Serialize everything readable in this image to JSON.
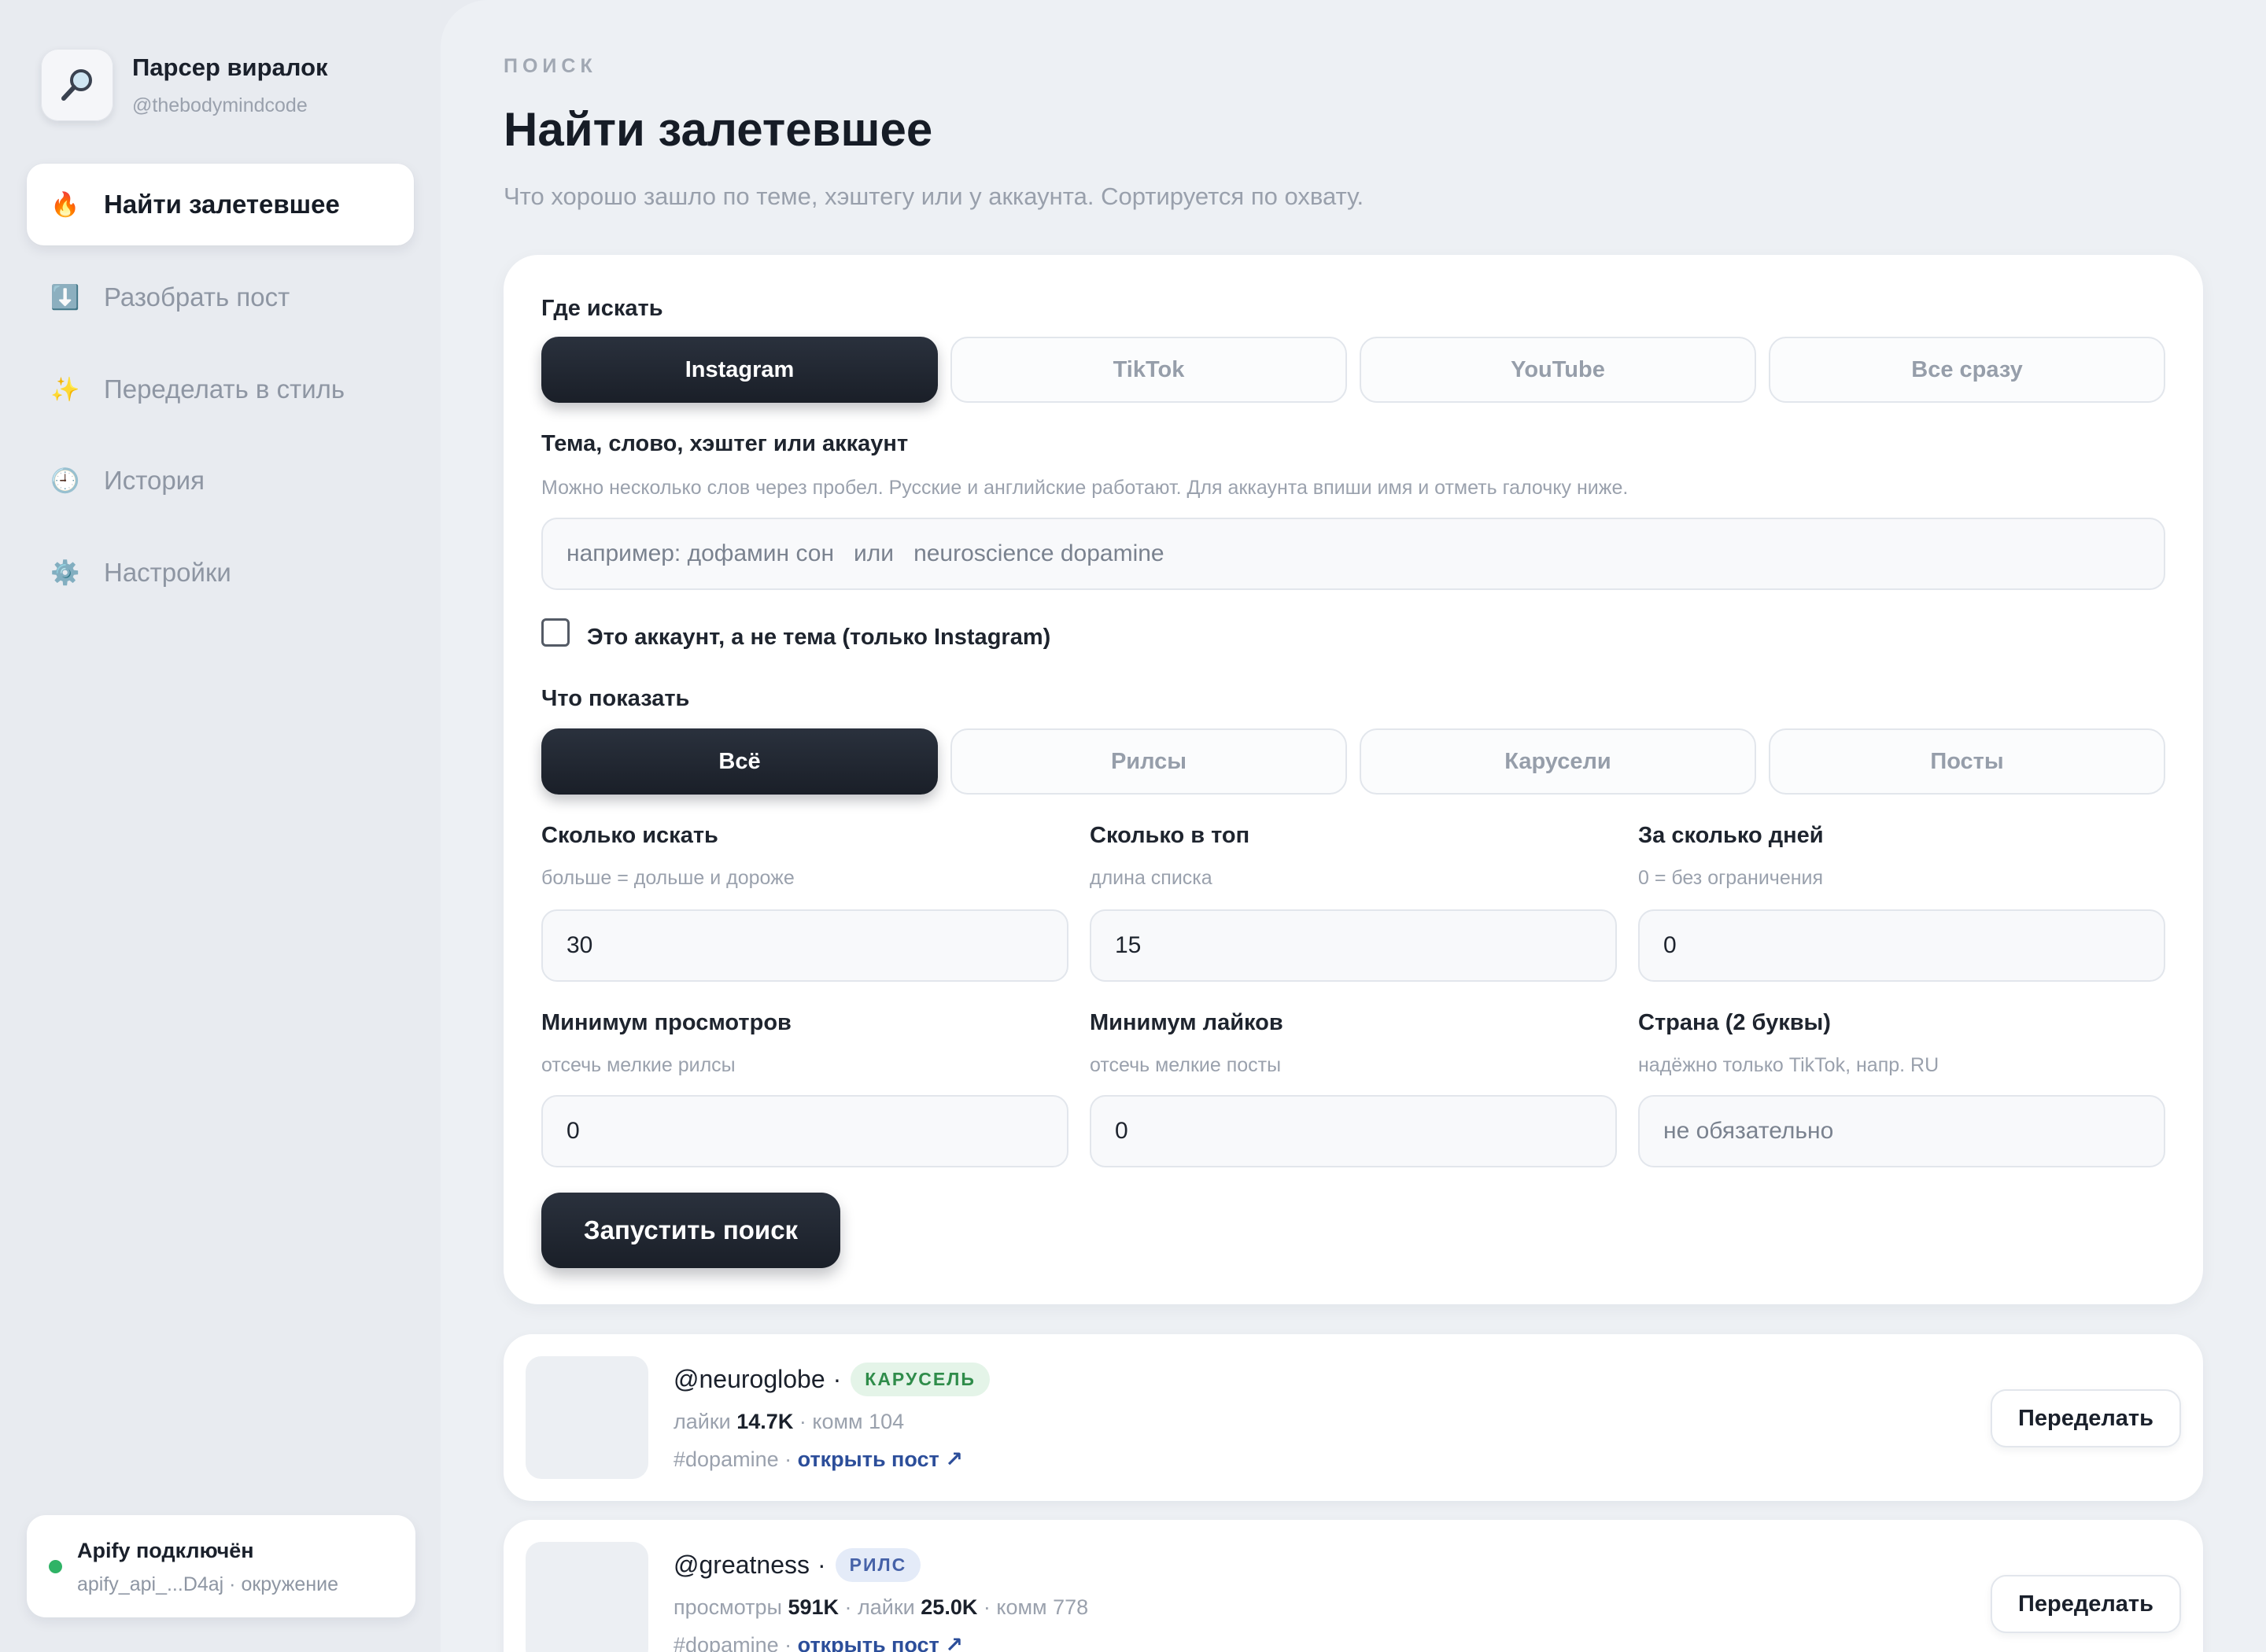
{
  "brand": {
    "logo_icon": "magnifier-icon",
    "title": "Парсер виралок",
    "subtitle": "@thebodymindcode"
  },
  "nav": {
    "items": [
      {
        "icon": "🔥",
        "icon_name": "fire-icon",
        "label": "Найти залетевшее",
        "active": true
      },
      {
        "icon": "⬇️",
        "icon_name": "download-icon",
        "label": "Разобрать пост",
        "active": false
      },
      {
        "icon": "✨",
        "icon_name": "sparkles-icon",
        "label": "Переделать в стиль",
        "active": false
      },
      {
        "icon": "🕘",
        "icon_name": "clock-icon",
        "label": "История",
        "active": false
      },
      {
        "icon": "⚙️",
        "icon_name": "gear-icon",
        "label": "Настройки",
        "active": false
      }
    ]
  },
  "status": {
    "title": "Apify подключён",
    "subtitle": "apify_api_...D4aj · окружение",
    "color": "#2fb366"
  },
  "header": {
    "eyebrow": "ПОИСК",
    "title": "Найти залетевшее",
    "subtitle": "Что хорошо зашло по теме, хэштегу или у аккаунта. Сортируется по охвату."
  },
  "form": {
    "platform": {
      "label": "Где искать",
      "options": [
        "Instagram",
        "TikTok",
        "YouTube",
        "Все сразу"
      ],
      "selected": "Instagram"
    },
    "query": {
      "label": "Тема, слово, хэштег или аккаунт",
      "hint": "Можно несколько слов через пробел. Русские и английские работают. Для аккаунта впиши имя и отметь галочку ниже.",
      "placeholder": "например: дофамин сон   или   neuroscience dopamine",
      "value": ""
    },
    "account_checkbox": {
      "label": "Это аккаунт, а не тема (только Instagram)",
      "checked": false
    },
    "content_type": {
      "label": "Что показать",
      "options": [
        "Всё",
        "Рилсы",
        "Карусели",
        "Посты"
      ],
      "selected": "Всё"
    },
    "search_count": {
      "label": "Сколько искать",
      "hint": "больше = дольше и дороже",
      "value": "30"
    },
    "top_count": {
      "label": "Сколько в топ",
      "hint": "длина списка",
      "value": "15"
    },
    "days": {
      "label": "За сколько дней",
      "hint": "0 = без ограничения",
      "value": "0"
    },
    "min_views": {
      "label": "Минимум просмотров",
      "hint": "отсечь мелкие рилсы",
      "value": "0"
    },
    "min_likes": {
      "label": "Минимум лайков",
      "hint": "отсечь мелкие посты",
      "value": "0"
    },
    "country": {
      "label": "Страна (2 буквы)",
      "hint": "надёжно только TikTok, напр. RU",
      "placeholder": "не обязательно",
      "value": ""
    },
    "submit_label": "Запустить поиск"
  },
  "results": [
    {
      "handle": "@neuroglobe",
      "dot": "·",
      "badge": "КАРУСЕЛЬ",
      "badge_kind": "carousel",
      "stats": [
        {
          "name": "лайки",
          "value": "14.7K",
          "bold": true
        },
        {
          "name": "комм",
          "value": "104",
          "bold": false
        }
      ],
      "hashtag": "#dopamine",
      "link_label": "открыть пост ↗",
      "action_label": "Переделать"
    },
    {
      "handle": "@greatness",
      "dot": "·",
      "badge": "РИЛС",
      "badge_kind": "reels",
      "stats": [
        {
          "name": "просмотры",
          "value": "591K",
          "bold": true
        },
        {
          "name": "лайки",
          "value": "25.0K",
          "bold": true
        },
        {
          "name": "комм",
          "value": "778",
          "bold": false
        }
      ],
      "hashtag": "#dopamine",
      "link_label": "открыть пост ↗",
      "action_label": "Переделать"
    }
  ]
}
